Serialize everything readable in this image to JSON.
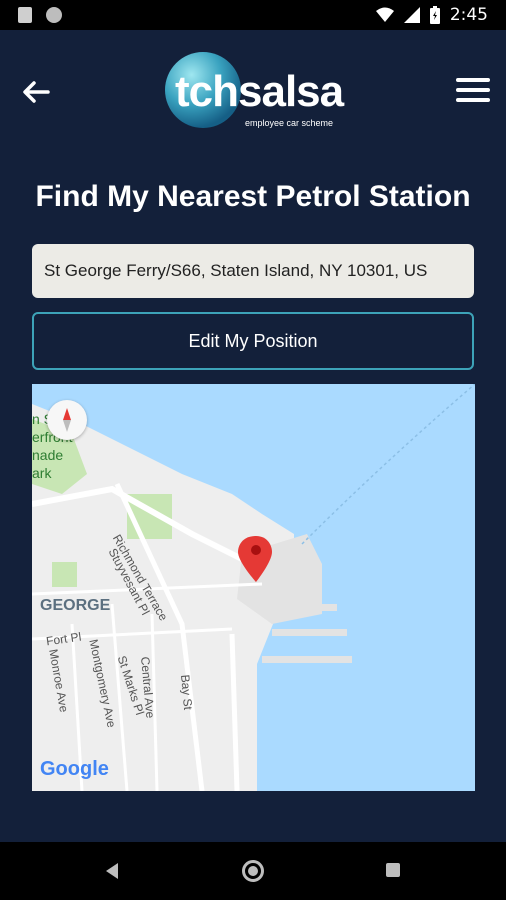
{
  "status": {
    "time": "2:45"
  },
  "header": {
    "logo_primary": "tchsalsa",
    "logo_tagline": "employee car scheme"
  },
  "page": {
    "title": "Find My Nearest Petrol Station"
  },
  "location": {
    "address": "St George Ferry/S66, Staten Island, NY 10301, US",
    "edit_label": "Edit My Position"
  },
  "map": {
    "labels": {
      "park_1": "n Shore",
      "park_2": "erfront",
      "park_3": "nade",
      "park_4": "ark",
      "neighborhood": "GEORGE",
      "st_richmond": "Richmond Terrace",
      "st_stuyvesant": "Stuyvesant Pl",
      "st_fort": "Fort Pl",
      "st_monroe": "Monroe Ave",
      "st_montgomery": "Montgomery Ave",
      "st_marks": "St Marks Pl",
      "st_central": "Central Ave",
      "st_bay": "Bay St"
    },
    "provider": "Google",
    "colors": {
      "water": "#aadaff",
      "land": "#eeeeee",
      "park": "#c8e6b4",
      "pin": "#e53935"
    }
  },
  "theme": {
    "background": "#13203a",
    "accent": "#3da3b8"
  }
}
